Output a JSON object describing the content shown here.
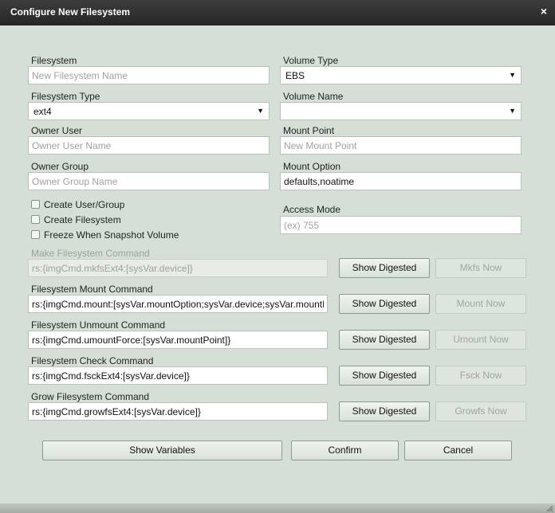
{
  "dialog": {
    "title": "Configure New Filesystem",
    "close_label": "×"
  },
  "fields": {
    "filesystem": {
      "label": "Filesystem",
      "value": "",
      "placeholder": "New Filesystem Name"
    },
    "volume_type": {
      "label": "Volume Type",
      "value": "EBS"
    },
    "filesystem_type": {
      "label": "Filesystem Type",
      "value": "ext4"
    },
    "volume_name": {
      "label": "Volume Name",
      "value": ""
    },
    "owner_user": {
      "label": "Owner User",
      "value": "",
      "placeholder": "Owner User Name"
    },
    "mount_point": {
      "label": "Mount Point",
      "value": "",
      "placeholder": "New Mount Point"
    },
    "owner_group": {
      "label": "Owner Group",
      "value": "",
      "placeholder": "Owner Group Name"
    },
    "mount_option": {
      "label": "Mount Option",
      "value": "defaults,noatime"
    },
    "access_mode": {
      "label": "Access Mode",
      "value": "",
      "placeholder": "(ex) 755"
    }
  },
  "checkboxes": {
    "create_user_group": {
      "label": "Create User/Group",
      "checked": false
    },
    "create_filesystem": {
      "label": "Create Filesystem",
      "checked": false
    },
    "freeze_snapshot": {
      "label": "Freeze When Snapshot Volume",
      "checked": false
    }
  },
  "commands": {
    "make": {
      "label": "Make Filesystem Command",
      "value": "rs:{imgCmd.mkfsExt4:[sysVar.device]}",
      "digest_label": "Show Digested",
      "now_label": "Mkfs Now",
      "enabled": false
    },
    "mount": {
      "label": "Filesystem Mount Command",
      "value": "rs:{imgCmd.mount:[sysVar.mountOption;sysVar.device;sysVar.mountPoint]}",
      "digest_label": "Show Digested",
      "now_label": "Mount Now"
    },
    "unmount": {
      "label": "Filesystem Unmount Command",
      "value": "rs:{imgCmd.umountForce:[sysVar.mountPoint]}",
      "digest_label": "Show Digested",
      "now_label": "Umount Now"
    },
    "check": {
      "label": "Filesystem Check Command",
      "value": "rs:{imgCmd.fsckExt4:[sysVar.device]}",
      "digest_label": "Show Digested",
      "now_label": "Fsck Now"
    },
    "grow": {
      "label": "Grow Filesystem Command",
      "value": "rs:{imgCmd.growfsExt4:[sysVar.device]}",
      "digest_label": "Show Digested",
      "now_label": "Growfs Now"
    }
  },
  "footer": {
    "show_variables": "Show Variables",
    "confirm": "Confirm",
    "cancel": "Cancel"
  },
  "icons": {
    "dropdown_arrow": "▼",
    "close": "×"
  },
  "colors": {
    "background": "#d5dfd5",
    "titlebar": "#2e2e2e"
  }
}
